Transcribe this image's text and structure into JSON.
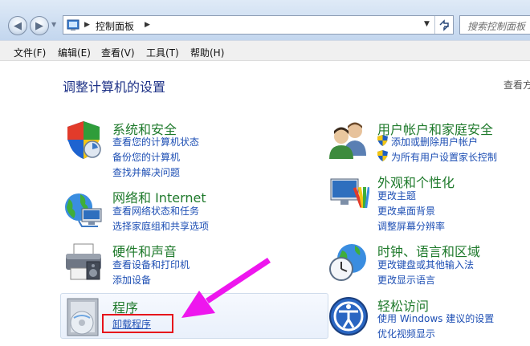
{
  "breadcrumb": {
    "location": "控制面板"
  },
  "search": {
    "placeholder": "搜索控制面板"
  },
  "menu": [
    "文件(F)",
    "编辑(E)",
    "查看(V)",
    "工具(T)",
    "帮助(H)"
  ],
  "page": {
    "title": "调整计算机的设置",
    "view_by": "查看方"
  },
  "categories": {
    "system": {
      "title": "系统和安全",
      "links": [
        "查看您的计算机状态",
        "备份您的计算机",
        "查找并解决问题"
      ]
    },
    "network": {
      "title": "网络和 Internet",
      "links": [
        "查看网络状态和任务",
        "选择家庭组和共享选项"
      ]
    },
    "hardware": {
      "title": "硬件和声音",
      "links": [
        "查看设备和打印机",
        "添加设备"
      ]
    },
    "programs": {
      "title": "程序",
      "links": [
        "卸载程序"
      ]
    },
    "users": {
      "title": "用户帐户和家庭安全",
      "links": [
        "添加或删除用户帐户",
        "为所有用户设置家长控制"
      ]
    },
    "appearance": {
      "title": "外观和个性化",
      "links": [
        "更改主题",
        "更改桌面背景",
        "调整屏幕分辨率"
      ]
    },
    "clock": {
      "title": "时钟、语言和区域",
      "links": [
        "更改键盘或其他输入法",
        "更改显示语言"
      ]
    },
    "ease": {
      "title": "轻松访问",
      "links": [
        "使用 Windows 建议的设置",
        "优化视频显示"
      ]
    }
  },
  "colors": {
    "annotation_arrow": "#ee16ee",
    "annotation_box": "#e6121b",
    "category_title": "#1f7a2c",
    "link": "#1e4fb4"
  }
}
